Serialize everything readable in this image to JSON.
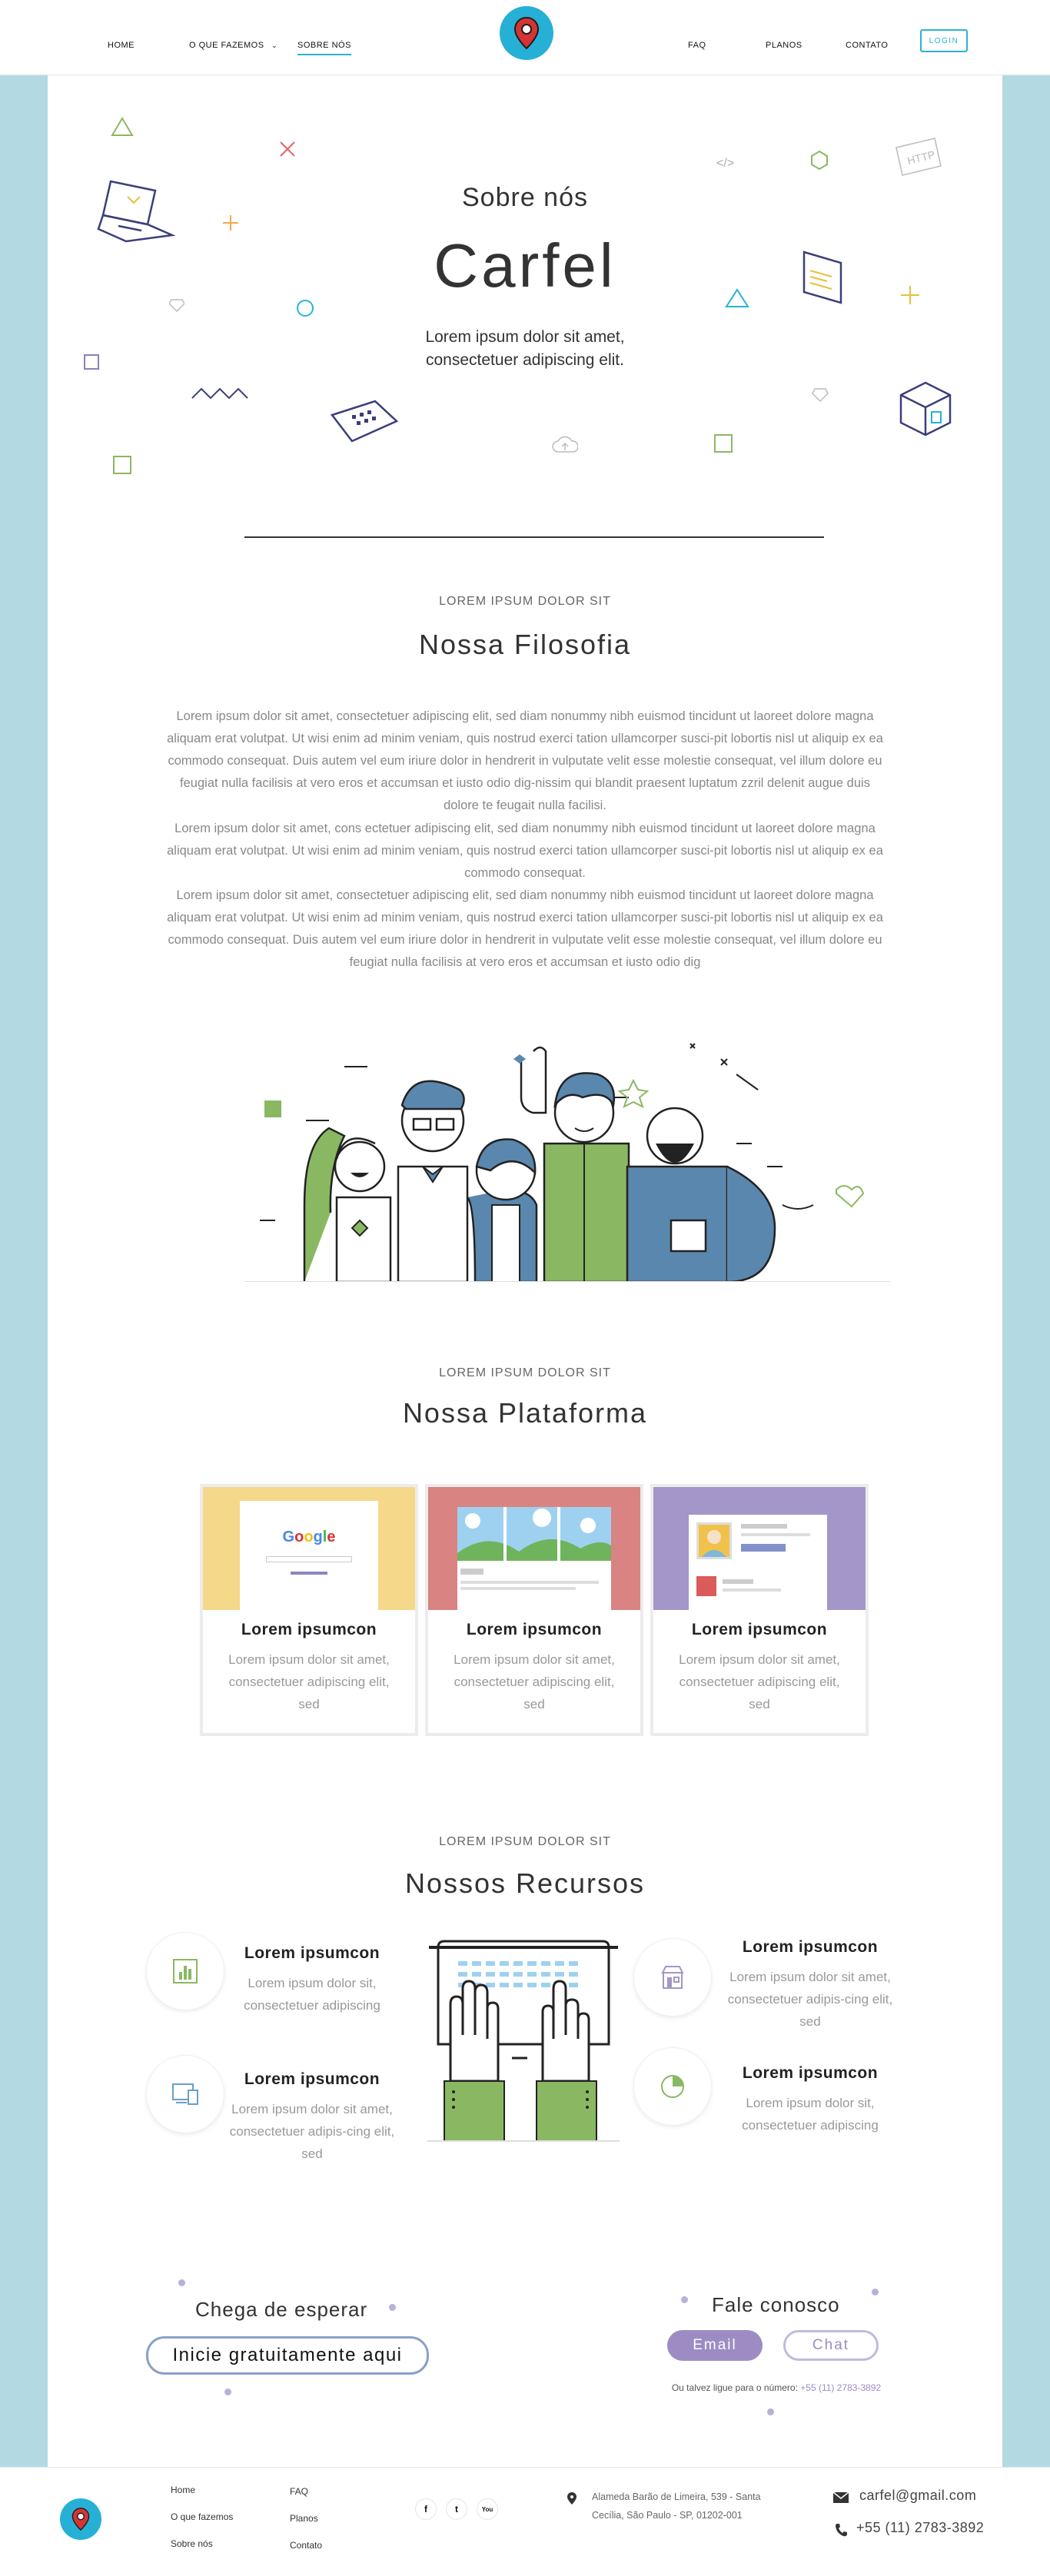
{
  "nav": {
    "left": [
      "HOME",
      "O QUE FAZEMOS",
      "SOBRE NÓS"
    ],
    "right": [
      "FAQ",
      "PLANOS",
      "CONTATO"
    ],
    "login": "LOGIN"
  },
  "hero": {
    "subtitle": "Sobre nós",
    "title": "Carfel",
    "description": "Lorem ipsum dolor sit amet, consectetuer adipiscing elit.",
    "code_tag": "</>",
    "http_tag": "HTTP"
  },
  "philosophy": {
    "eyebrow": "LOREM IPSUM DOLOR SIT",
    "title": "Nossa Filosofia",
    "paragraph1": "Lorem ipsum dolor sit amet, consectetuer adipiscing elit, sed diam nonummy nibh euismod tincidunt ut laoreet dolore magna aliquam erat volutpat. Ut wisi enim ad minim veniam, quis nostrud exerci tation ullamcorper susci-pit lobortis nisl ut aliquip ex ea commodo consequat. Duis autem vel eum iriure dolor in hendrerit in vulputate velit esse molestie consequat, vel illum dolore eu feugiat nulla facilisis at vero eros et accumsan et iusto odio dig-nissim qui blandit praesent luptatum zzril delenit augue duis dolore te feugait nulla facilisi.",
    "paragraph2": "Lorem ipsum dolor sit amet, cons ectetuer adipiscing elit, sed diam nonummy nibh euismod tincidunt ut laoreet dolore magna aliquam erat volutpat. Ut wisi enim ad minim veniam, quis nostrud exerci tation ullamcorper susci-pit lobortis nisl ut aliquip ex ea commodo consequat.",
    "paragraph3": "Lorem ipsum dolor sit amet, consectetuer adipiscing elit, sed diam nonummy nibh euismod tincidunt ut laoreet dolore magna aliquam erat volutpat. Ut wisi enim ad minim veniam, quis nostrud exerci tation ullamcorper susci-pit lobortis nisl ut aliquip ex ea commodo consequat. Duis autem vel eum iriure dolor in hendrerit in vulputate velit esse molestie consequat, vel illum dolore eu feugiat nulla facilisis at vero eros et accumsan et iusto odio dig"
  },
  "platform": {
    "eyebrow": "LOREM IPSUM DOLOR SIT",
    "title": "Nossa Plataforma",
    "cards": [
      {
        "title": "Lorem ipsumcon",
        "desc": "Lorem ipsum dolor sit amet, consectetuer adipiscing elit, sed",
        "color": "#f6d88a",
        "logo": "Google"
      },
      {
        "title": "Lorem ipsumcon",
        "desc": "Lorem ipsum dolor sit amet, consectetuer adipiscing elit, sed",
        "color": "#d98383"
      },
      {
        "title": "Lorem ipsumcon",
        "desc": "Lorem ipsum dolor sit amet, consectetuer adipiscing elit, sed",
        "color": "#a496c8"
      }
    ]
  },
  "resources": {
    "eyebrow": "LOREM IPSUM DOLOR SIT",
    "title": "Nossos Recursos",
    "items": [
      {
        "title": "Lorem ipsumcon",
        "desc": "Lorem ipsum dolor sit, consectetuer adipiscing",
        "icon": "chart-icon"
      },
      {
        "title": "Lorem ipsumcon",
        "desc": "Lorem ipsum dolor sit amet, consectetuer adipis-cing elit, sed",
        "icon": "devices-icon"
      },
      {
        "title": "Lorem ipsumcon",
        "desc": "Lorem ipsum dolor sit amet, consectetuer adipis-cing elit, sed",
        "icon": "store-icon"
      },
      {
        "title": "Lorem ipsumcon",
        "desc": "Lorem ipsum dolor sit, consectetuer adipiscing",
        "icon": "pie-chart-icon"
      }
    ]
  },
  "cta": {
    "wait_text": "Chega de esperar",
    "start_button": "Inicie gratuitamente aqui",
    "contact_text": "Fale conosco",
    "email_button": "Email",
    "chat_button": "Chat",
    "phone_prefix": "Ou talvez ligue para o número:",
    "phone_number": "+55 (11) 2783-3892"
  },
  "footer": {
    "col1": [
      "Home",
      "O que fazemos",
      "Sobre nós"
    ],
    "col2": [
      "FAQ",
      "Planos",
      "Contato"
    ],
    "social": [
      "f",
      "t",
      "You"
    ],
    "address": "Alameda Barão de Limeira, 539 - Santa Cecília, São Paulo - SP, 01202-001",
    "email": "carfel@gmail.com",
    "phone": "+55 (11) 2783-3892"
  },
  "colors": {
    "accent_blue": "#27b0d6",
    "frame": "#b3dae2",
    "purple": "#9d8cc4",
    "green": "#8ab862",
    "steel_blue": "#5a87ad"
  }
}
